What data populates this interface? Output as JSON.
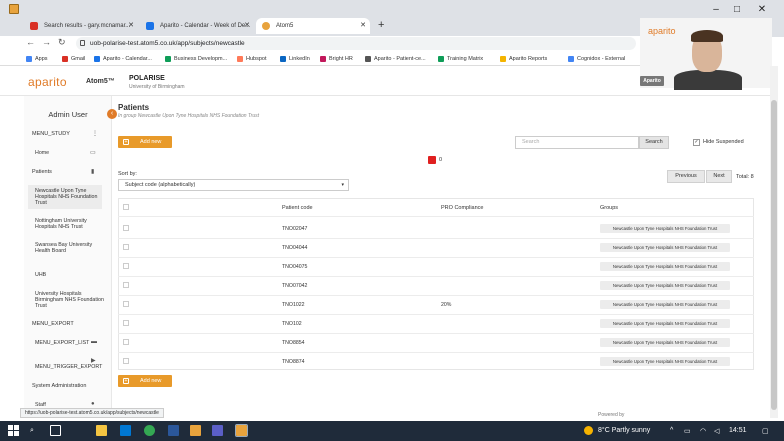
{
  "browser": {
    "tabs": [
      {
        "title": "Search results - gary.mcnamar...",
        "color": "#d93025"
      },
      {
        "title": "Aparito - Calendar - Week of De...",
        "color": "#1a73e8"
      },
      {
        "title": "Atom5",
        "color": "#e8a33d"
      }
    ],
    "url": "uob-polarise-test.atom5.co.uk/app/subjects/newcastle",
    "status_url": "https://uob-polarise-test.atom5.co.uk/app/subjects/newcastle",
    "bookmarks": [
      {
        "label": "Apps",
        "color": "#4285f4"
      },
      {
        "label": "Gmail",
        "color": "#d93025"
      },
      {
        "label": "Aparito - Calendar...",
        "color": "#1a73e8"
      },
      {
        "label": "Business Developm...",
        "color": "#0f9d58"
      },
      {
        "label": "Hubspot",
        "color": "#ff7a59"
      },
      {
        "label": "LinkedIn",
        "color": "#0a66c2"
      },
      {
        "label": "Bright HR",
        "color": "#c2185b"
      },
      {
        "label": "Aparito - Patient-ce...",
        "color": "#555555"
      },
      {
        "label": "Training Matrix",
        "color": "#0f9d58"
      },
      {
        "label": "Aparito Reports",
        "color": "#f4b400"
      },
      {
        "label": "Cognidox - External",
        "color": "#4285f4"
      }
    ]
  },
  "app": {
    "logo": "aparito",
    "product": "Atom5™",
    "project": "POLARISE",
    "university": "University of Birmingham",
    "badge": "Aparito",
    "cam_logo": "aparito"
  },
  "sidebar": {
    "title": "Admin User",
    "menu_study": "MENU_STUDY",
    "home": "Home",
    "patients": "Patients",
    "sites": [
      "Newcastle Upon Tyne Hospitals NHS Foundation Trust",
      "Nottingham University Hospitals NHS Trust",
      "Swansea Bay University Health Board",
      "UHB",
      "University Hospitals Birmingham NHS Foundation Trust"
    ],
    "menu_export": "MENU_EXPORT",
    "menu_export_list": "MENU_EXPORT_LIST",
    "menu_trigger_export": "MENU_TRIGGER_EXPORT",
    "system_admin": "System Administration",
    "staff": "Staff"
  },
  "main": {
    "title": "Patients",
    "subtitle": "In group Newcastle Upon Tyne Hospitals NHS Foundation Trust",
    "add_new": "Add new",
    "search_placeholder": "Search",
    "search_button": "Search",
    "hide_suspended": "Hide Suspended",
    "flag_count": "0",
    "sort_label": "Sort by:",
    "sort_value": "Subject code (alphabetically)",
    "previous": "Previous",
    "next": "Next",
    "total": "Total: 8",
    "columns": [
      "Patient code",
      "PRO Compliance",
      "Groups"
    ],
    "rows": [
      {
        "code": "TNO02047",
        "compliance": "",
        "group": "Newcastle Upon Tyne Hospitals NHS Foundation Trust"
      },
      {
        "code": "TNO04044",
        "compliance": "",
        "group": "Newcastle Upon Tyne Hospitals NHS Foundation Trust"
      },
      {
        "code": "TNO04075",
        "compliance": "",
        "group": "Newcastle Upon Tyne Hospitals NHS Foundation Trust"
      },
      {
        "code": "TNO07042",
        "compliance": "",
        "group": "Newcastle Upon Tyne Hospitals NHS Foundation Trust"
      },
      {
        "code": "TNO1022",
        "compliance": "20%",
        "group": "Newcastle Upon Tyne Hospitals NHS Foundation Trust"
      },
      {
        "code": "TNO102",
        "compliance": "",
        "group": "Newcastle Upon Tyne Hospitals NHS Foundation Trust"
      },
      {
        "code": "TNO8854",
        "compliance": "",
        "group": "Newcastle Upon Tyne Hospitals NHS Foundation Trust"
      },
      {
        "code": "TNO8874",
        "compliance": "",
        "group": "Newcastle Upon Tyne Hospitals NHS Foundation Trust"
      }
    ],
    "powered_by": "Powered by"
  },
  "taskbar": {
    "weather": "8°C  Partly sunny",
    "time": "14:51"
  }
}
